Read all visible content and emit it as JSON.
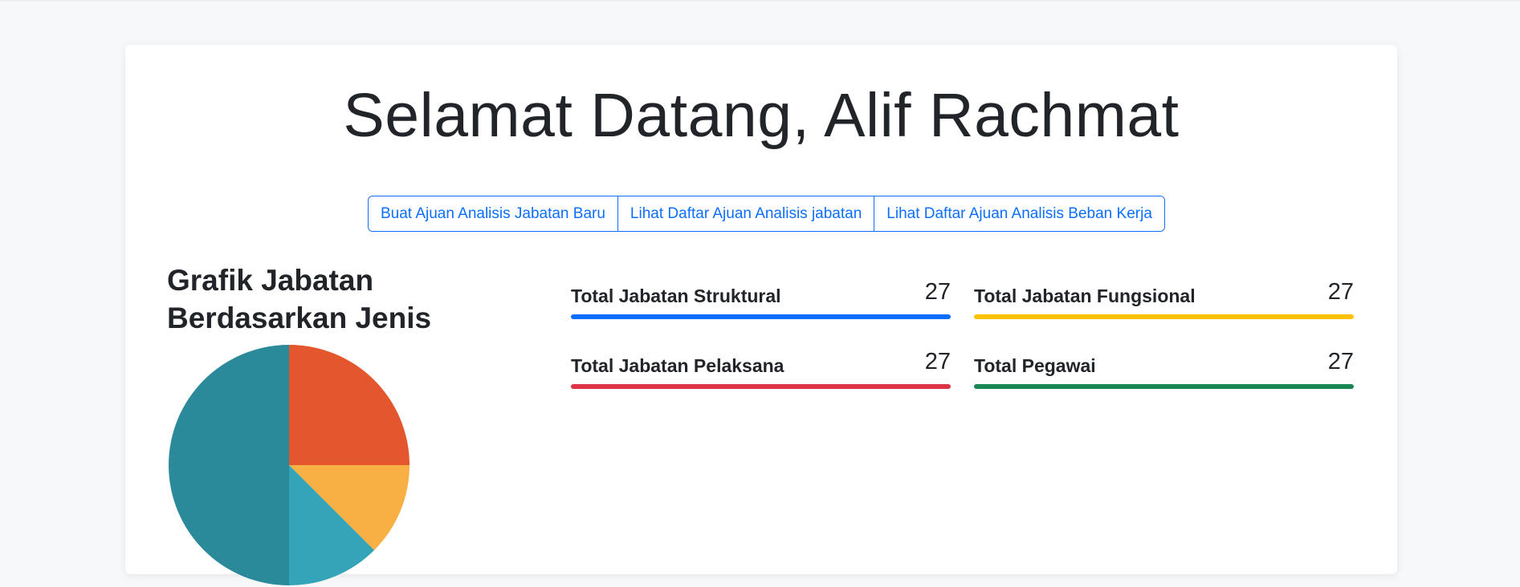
{
  "header": {
    "welcome": "Selamat Datang, Alif Rachmat"
  },
  "actions": [
    {
      "label": "Buat Ajuan Analisis Jabatan Baru"
    },
    {
      "label": "Lihat Daftar Ajuan Analisis jabatan"
    },
    {
      "label": "Lihat Daftar Ajuan Analisis Beban Kerja"
    }
  ],
  "chart": {
    "title": "Grafik Jabatan Berdasarkan Jenis"
  },
  "stats": [
    {
      "label": "Total Jabatan Struktural",
      "value": "27",
      "color": "#0d6efd"
    },
    {
      "label": "Total Jabatan Fungsional",
      "value": "27",
      "color": "#ffc107"
    },
    {
      "label": "Total Jabatan Pelaksana",
      "value": "27",
      "color": "#dc3545"
    },
    {
      "label": "Total Pegawai",
      "value": "27",
      "color": "#198754"
    }
  ],
  "chart_data": {
    "type": "pie",
    "title": "",
    "slices": [
      {
        "value": 25,
        "color": "#e4572e"
      },
      {
        "value": 12.5,
        "color": "#f8b045"
      },
      {
        "value": 12.5,
        "color": "#35a4b9"
      },
      {
        "value": 50,
        "color": "#2b8a99"
      }
    ]
  }
}
